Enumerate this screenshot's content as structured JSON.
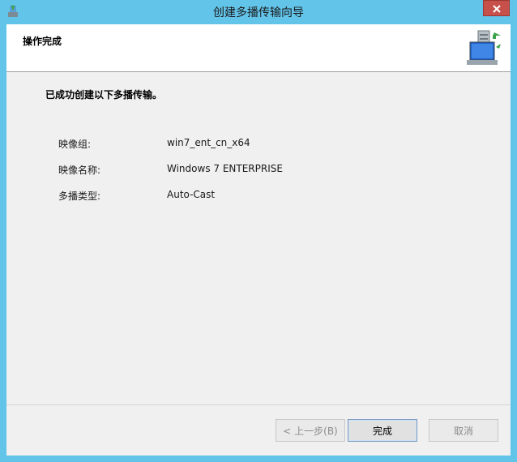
{
  "window": {
    "title": "创建多播传输向导",
    "icon": "network-wizard-icon",
    "close_icon": "close-icon"
  },
  "header": {
    "title": "操作完成",
    "icon": "server-network-icon"
  },
  "main": {
    "success_message": "已成功创建以下多播传输。",
    "fields": [
      {
        "label": "映像组:",
        "value": "win7_ent_cn_x64"
      },
      {
        "label": "映像名称:",
        "value": "Windows 7 ENTERPRISE"
      },
      {
        "label": "多播类型:",
        "value": "Auto-Cast"
      }
    ]
  },
  "footer": {
    "back_label": "< 上一步(B)",
    "finish_label": "完成",
    "cancel_label": "取消"
  },
  "colors": {
    "titlebar": "#63c4ea",
    "close_button": "#c7504b",
    "client_background": "#f0f0f0"
  }
}
